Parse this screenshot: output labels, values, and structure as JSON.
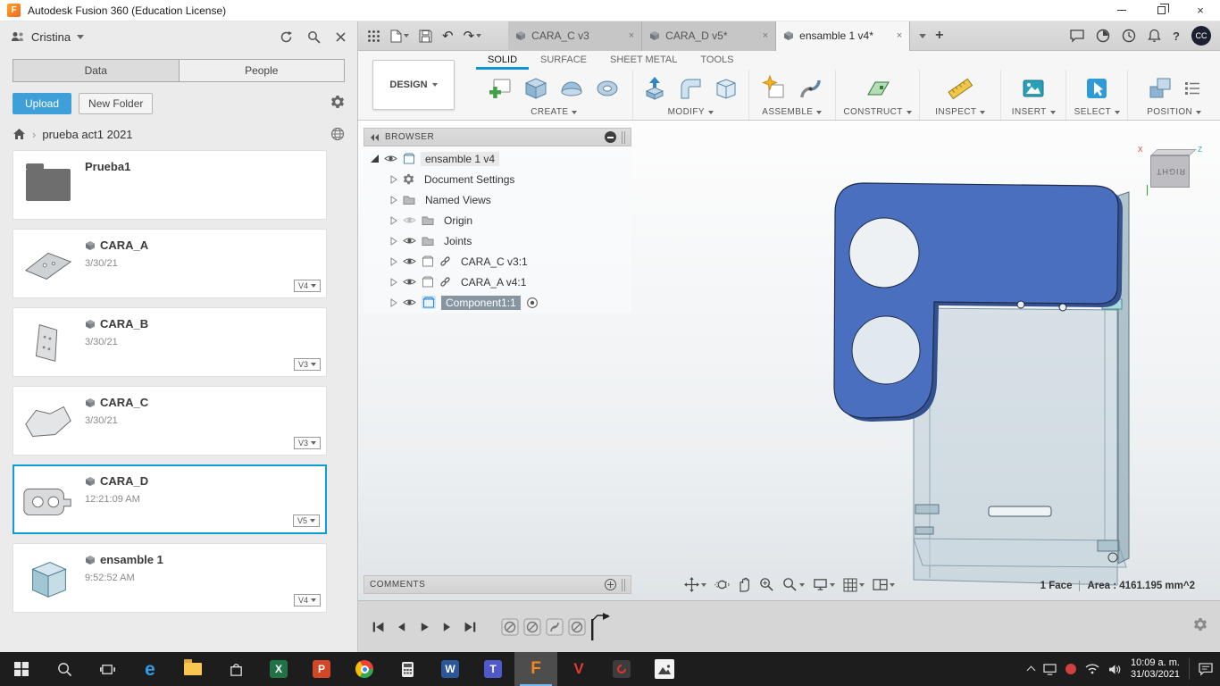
{
  "colors": {
    "accent": "#0696d7",
    "fusion_orange": "#f6871f",
    "part_blue": "#4a6fbe",
    "upload_blue": "#3f9fd8"
  },
  "glyphs": {
    "close": "×",
    "undo": "↶",
    "redo": "↷",
    "plus": "+",
    "help": "?",
    "crumb_sep": "›"
  },
  "title_bar": {
    "app_title": "Autodesk Fusion 360 (Education License)"
  },
  "data_panel": {
    "user_name": "Cristina",
    "tabs": {
      "data": "Data",
      "people": "People"
    },
    "actions": {
      "upload": "Upload",
      "new_folder": "New Folder"
    },
    "breadcrumb": {
      "path": "prueba act1 2021"
    },
    "items": [
      {
        "name": "Prueba1"
      },
      {
        "name": "CARA_A",
        "date": "3/30/21",
        "version": "V4"
      },
      {
        "name": "CARA_B",
        "date": "3/30/21",
        "version": "V3"
      },
      {
        "name": "CARA_C",
        "date": "3/30/21",
        "version": "V3"
      },
      {
        "name": "CARA_D",
        "date": "12:21:09 AM",
        "version": "V5"
      },
      {
        "name": "ensamble 1",
        "date": "9:52:52 AM",
        "version": "V4"
      }
    ]
  },
  "app_toolbar": {
    "tabs": [
      {
        "label": "CARA_C v3"
      },
      {
        "label": "CARA_D v5*"
      },
      {
        "label": "ensamble 1 v4*"
      }
    ],
    "avatar_initials": "CC"
  },
  "ribbon": {
    "design_menu": "DESIGN",
    "tabs": [
      "SOLID",
      "SURFACE",
      "SHEET METAL",
      "TOOLS"
    ],
    "groups": [
      "CREATE",
      "MODIFY",
      "ASSEMBLE",
      "CONSTRUCT",
      "INSPECT",
      "INSERT",
      "SELECT",
      "POSITION"
    ]
  },
  "browser": {
    "header": "BROWSER",
    "root_label": "ensamble 1 v4",
    "nodes": [
      "Document Settings",
      "Named Views",
      "Origin",
      "Joints",
      "CARA_C v3:1",
      "CARA_A v4:1",
      "Component1:1"
    ]
  },
  "comments_panel": {
    "header": "COMMENTS"
  },
  "viewport": {
    "view_cube_face": "RIGHT",
    "axis_x": "X",
    "axis_z": "Z",
    "selection_info": "1 Face",
    "area_info": "Area : 4161.195 mm^2"
  },
  "taskbar": {
    "time": "10:09 a. m.",
    "date": "31/03/2021"
  }
}
